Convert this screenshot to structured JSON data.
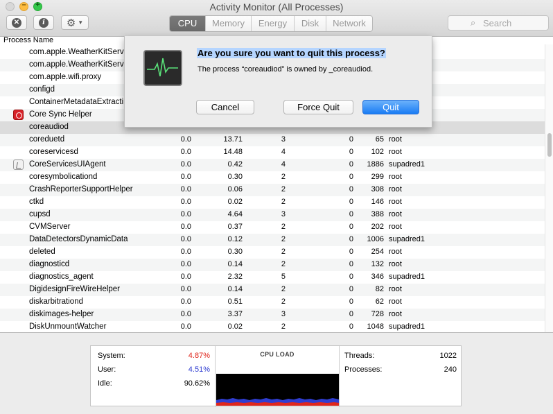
{
  "window": {
    "title": "Activity Monitor (All Processes)"
  },
  "toolbar": {
    "stop_icon": "x-circle-icon",
    "info_icon": "info-circle-icon",
    "gear_icon": "gear-icon",
    "tabs": [
      "CPU",
      "Memory",
      "Energy",
      "Disk",
      "Network"
    ],
    "active_tab": "CPU",
    "search_placeholder": "Search"
  },
  "table": {
    "column_header": "Process Name",
    "rows": [
      {
        "name": "com.apple.WeatherKitServ",
        "cpu": "",
        "cpu_time": "",
        "threads": "",
        "idle_wake": "",
        "pid": "",
        "user": "",
        "icon": ""
      },
      {
        "name": "com.apple.WeatherKitServ",
        "cpu": "",
        "cpu_time": "",
        "threads": "",
        "idle_wake": "",
        "pid": "",
        "user": "",
        "icon": ""
      },
      {
        "name": "com.apple.wifi.proxy",
        "cpu": "",
        "cpu_time": "",
        "threads": "",
        "idle_wake": "",
        "pid": "",
        "user": "",
        "icon": ""
      },
      {
        "name": "configd",
        "cpu": "",
        "cpu_time": "",
        "threads": "",
        "idle_wake": "",
        "pid": "",
        "user": "",
        "icon": ""
      },
      {
        "name": "ContainerMetadataExtracti",
        "cpu": "",
        "cpu_time": "",
        "threads": "",
        "idle_wake": "",
        "pid": "",
        "user": "",
        "icon": ""
      },
      {
        "name": "Core Sync Helper",
        "cpu": "",
        "cpu_time": "",
        "threads": "",
        "idle_wake": "",
        "pid": "",
        "user": "",
        "icon": "adobe-icon"
      },
      {
        "name": "coreaudiod",
        "cpu": "",
        "cpu_time": "",
        "threads": "",
        "idle_wake": "",
        "pid": "",
        "user": "",
        "icon": ""
      },
      {
        "name": "coreduetd",
        "cpu": "0.0",
        "cpu_time": "13.71",
        "threads": "3",
        "idle_wake": "0",
        "pid": "65",
        "user": "root",
        "icon": ""
      },
      {
        "name": "coreservicesd",
        "cpu": "0.0",
        "cpu_time": "14.48",
        "threads": "4",
        "idle_wake": "0",
        "pid": "102",
        "user": "root",
        "icon": ""
      },
      {
        "name": "CoreServicesUIAgent",
        "cpu": "0.0",
        "cpu_time": "0.42",
        "threads": "4",
        "idle_wake": "0",
        "pid": "1886",
        "user": "supadred1",
        "icon": "document-icon"
      },
      {
        "name": "coresymbolicationd",
        "cpu": "0.0",
        "cpu_time": "0.30",
        "threads": "2",
        "idle_wake": "0",
        "pid": "299",
        "user": "root",
        "icon": ""
      },
      {
        "name": "CrashReporterSupportHelper",
        "cpu": "0.0",
        "cpu_time": "0.06",
        "threads": "2",
        "idle_wake": "0",
        "pid": "308",
        "user": "root",
        "icon": ""
      },
      {
        "name": "ctkd",
        "cpu": "0.0",
        "cpu_time": "0.02",
        "threads": "2",
        "idle_wake": "0",
        "pid": "146",
        "user": "root",
        "icon": ""
      },
      {
        "name": "cupsd",
        "cpu": "0.0",
        "cpu_time": "4.64",
        "threads": "3",
        "idle_wake": "0",
        "pid": "388",
        "user": "root",
        "icon": ""
      },
      {
        "name": "CVMServer",
        "cpu": "0.0",
        "cpu_time": "0.37",
        "threads": "2",
        "idle_wake": "0",
        "pid": "202",
        "user": "root",
        "icon": ""
      },
      {
        "name": "DataDetectorsDynamicData",
        "cpu": "0.0",
        "cpu_time": "0.12",
        "threads": "2",
        "idle_wake": "0",
        "pid": "1006",
        "user": "supadred1",
        "icon": ""
      },
      {
        "name": "deleted",
        "cpu": "0.0",
        "cpu_time": "0.30",
        "threads": "2",
        "idle_wake": "0",
        "pid": "254",
        "user": "root",
        "icon": ""
      },
      {
        "name": "diagnosticd",
        "cpu": "0.0",
        "cpu_time": "0.14",
        "threads": "2",
        "idle_wake": "0",
        "pid": "132",
        "user": "root",
        "icon": ""
      },
      {
        "name": "diagnostics_agent",
        "cpu": "0.0",
        "cpu_time": "2.32",
        "threads": "5",
        "idle_wake": "0",
        "pid": "346",
        "user": "supadred1",
        "icon": ""
      },
      {
        "name": "DigidesignFireWireHelper",
        "cpu": "0.0",
        "cpu_time": "0.14",
        "threads": "2",
        "idle_wake": "0",
        "pid": "82",
        "user": "root",
        "icon": ""
      },
      {
        "name": "diskarbitrationd",
        "cpu": "0.0",
        "cpu_time": "0.51",
        "threads": "2",
        "idle_wake": "0",
        "pid": "62",
        "user": "root",
        "icon": ""
      },
      {
        "name": "diskimages-helper",
        "cpu": "0.0",
        "cpu_time": "3.37",
        "threads": "3",
        "idle_wake": "0",
        "pid": "728",
        "user": "root",
        "icon": ""
      },
      {
        "name": "DiskUnmountWatcher",
        "cpu": "0.0",
        "cpu_time": "0.02",
        "threads": "2",
        "idle_wake": "0",
        "pid": "1048",
        "user": "supadred1",
        "icon": ""
      }
    ],
    "selected_row": 6
  },
  "cpu_panel": {
    "system_label": "System:",
    "system_value": "4.87%",
    "user_label": "User:",
    "user_value": "4.51%",
    "idle_label": "Idle:",
    "idle_value": "90.62%",
    "graph_title": "CPU LOAD",
    "threads_label": "Threads:",
    "threads_value": "1022",
    "processes_label": "Processes:",
    "processes_value": "240",
    "colors": {
      "system": "#e0261c",
      "user": "#2f3dd1"
    }
  },
  "dialog": {
    "title": "Are you sure you want to quit this process?",
    "message": "The process “coreaudiod” is owned by _coreaudiod.",
    "cancel_label": "Cancel",
    "force_quit_label": "Force Quit",
    "quit_label": "Quit",
    "icon": "activity-monitor-icon"
  }
}
